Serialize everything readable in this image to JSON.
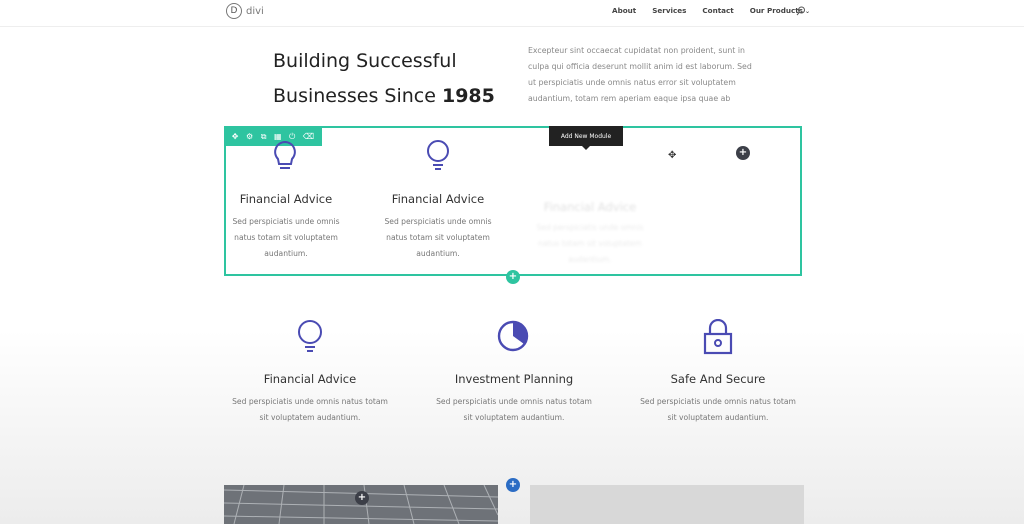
{
  "header": {
    "logo_letter": "D",
    "logo_text": "divi",
    "nav": [
      "About",
      "Services",
      "Contact",
      "Our Products"
    ]
  },
  "hero": {
    "title_line1": "Building Successful",
    "title_line2_prefix": "Businesses Since ",
    "title_line2_bold": "1985",
    "text": "Excepteur sint occaecat cupidatat non proident, sunt in culpa qui officia deserunt mollit anim id est laborum. Sed ut perspiciatis unde omnis natus error sit voluptatem audantium, totam rem aperiam eaque ipsa quae ab"
  },
  "builder": {
    "tooltip": "Add New Module",
    "toolbar_icons": [
      "move-icon",
      "gear-icon",
      "duplicate-icon",
      "columns-icon",
      "power-icon",
      "trash-icon"
    ],
    "accent": "#2ec4a0",
    "modules": [
      {
        "title": "Financial Advice",
        "desc_line1": "Sed perspiciatis unde omnis",
        "desc_line2": "natus totam sit voluptatem",
        "desc_line3": "audantium."
      },
      {
        "title": "Financial Advice",
        "desc_line1": "Sed perspiciatis unde omnis",
        "desc_line2": "natus totam sit voluptatem",
        "desc_line3": "audantium."
      },
      {
        "title": "Financial Advice",
        "desc_line1": "Sed perspiciatis unde omnis",
        "desc_line2": "natus totam sit voluptatem",
        "desc_line3": "audantium."
      }
    ]
  },
  "features": [
    {
      "icon": "lightbulb-icon",
      "title": "Financial Advice",
      "desc_line1": "Sed perspiciatis unde omnis natus totam",
      "desc_line2": "sit voluptatem audantium."
    },
    {
      "icon": "pie-chart-icon",
      "title": "Investment Planning",
      "desc_line1": "Sed perspiciatis unde omnis natus totam",
      "desc_line2": "sit voluptatem audantium."
    },
    {
      "icon": "lock-icon",
      "title": "Safe And Secure",
      "desc_line1": "Sed perspiciatis unde omnis natus totam",
      "desc_line2": "sit voluptatem audantium."
    }
  ],
  "colors": {
    "icon_purple": "#4a4bb3",
    "blue_button": "#2b6cc4",
    "dark_button": "#3c3f48"
  }
}
